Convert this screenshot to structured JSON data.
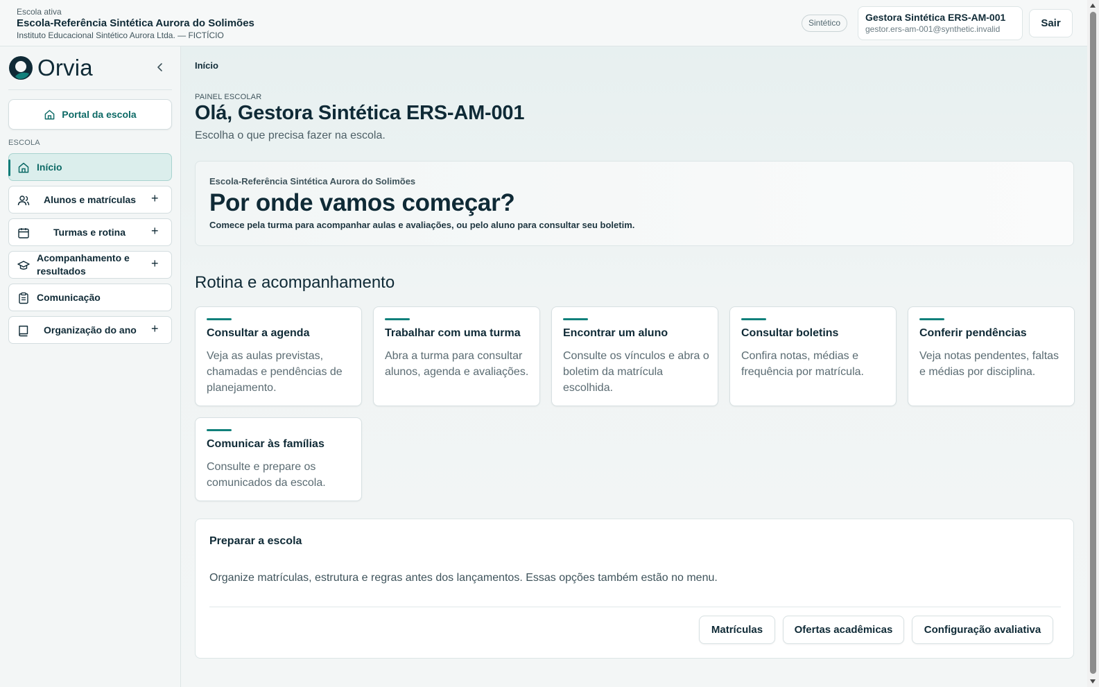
{
  "topbar": {
    "school_label": "Escola ativa",
    "school_name": "Escola-Referência Sintética Aurora do Solimões",
    "institution": "Instituto Educacional Sintético Aurora Ltda. — FICTÍCIO",
    "badge": "Sintético",
    "user_name": "Gestora Sintética ERS-AM-001",
    "user_email": "gestor.ers-am-001@synthetic.invalid",
    "logout_label": "Sair"
  },
  "sidebar": {
    "brand": "Orvia",
    "portal_label": "Portal da escola",
    "section_label": "ESCOLA",
    "items": [
      {
        "label": "Início",
        "icon": "home-icon",
        "expandable": false,
        "active": true
      },
      {
        "label": "Alunos e matrículas",
        "icon": "users-icon",
        "expandable": true,
        "active": false
      },
      {
        "label": "Turmas e rotina",
        "icon": "calendar-icon",
        "expandable": true,
        "active": false
      },
      {
        "label": "Acompanhamento e resultados",
        "icon": "graduation-cap-icon",
        "expandable": true,
        "active": false
      },
      {
        "label": "Comunicação",
        "icon": "clipboard-icon",
        "expandable": false,
        "active": false
      },
      {
        "label": "Organização do ano",
        "icon": "book-icon",
        "expandable": true,
        "active": false
      }
    ],
    "plus_symbol": "+"
  },
  "main": {
    "breadcrumb": "Início",
    "eyebrow": "PAINEL ESCOLAR",
    "greeting": "Olá, Gestora Sintética ERS-AM-001",
    "subgreeting": "Escolha o que precisa fazer na escola.",
    "hero": {
      "school": "Escola-Referência Sintética Aurora do Solimões",
      "title": "Por onde vamos começar?",
      "description": "Comece pela turma para acompanhar aulas e avaliações, ou pelo aluno para consultar seu boletim."
    },
    "section_title": "Rotina e acompanhamento",
    "cards": [
      {
        "title": "Consultar a agenda",
        "description": "Veja as aulas previstas, chamadas e pendências de planejamento."
      },
      {
        "title": "Trabalhar com uma turma",
        "description": "Abra a turma para consultar alunos, agenda e avaliações."
      },
      {
        "title": "Encontrar um aluno",
        "description": "Consulte os vínculos e abra o boletim da matrícula escolhida."
      },
      {
        "title": "Consultar boletins",
        "description": "Confira notas, médias e frequência por matrícula."
      },
      {
        "title": "Conferir pendências",
        "description": "Veja notas pendentes, faltas e médias por disciplina."
      },
      {
        "title": "Comunicar às famílias",
        "description": "Consulte e prepare os comunicados da escola."
      }
    ],
    "prep": {
      "title": "Preparar a escola",
      "description": "Organize matrículas, estrutura e regras antes dos lançamentos. Essas opções também estão no menu.",
      "buttons": [
        "Matrículas",
        "Ofertas acadêmicas",
        "Configuração avaliativa"
      ]
    }
  },
  "colors": {
    "accent": "#0d7c78",
    "text": "#0f2a36",
    "muted": "#5a6b72"
  }
}
